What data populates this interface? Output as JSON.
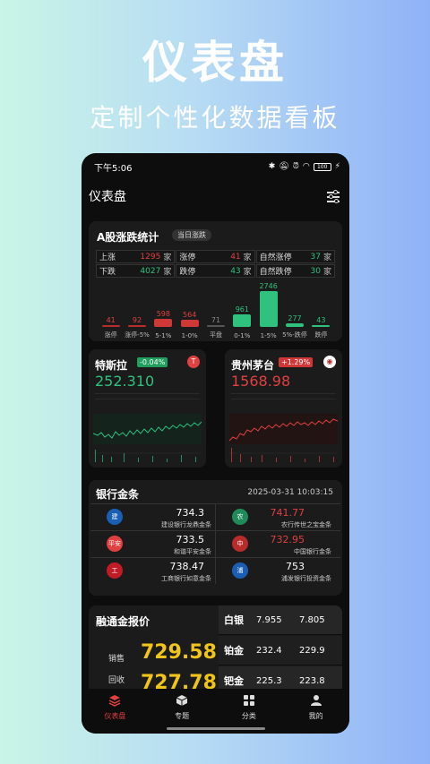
{
  "promo": {
    "title": "仪表盘",
    "subtitle": "定制个性化数据看板"
  },
  "status": {
    "time": "下午5:06",
    "battery": "100"
  },
  "header": {
    "title": "仪表盘"
  },
  "limit_stats": {
    "title": "A股涨跌统计",
    "pill": "当日涨跌",
    "rows": [
      [
        {
          "label": "上涨",
          "value": "1295",
          "unit": "家",
          "color": "red"
        },
        {
          "label": "涨停",
          "value": "41",
          "unit": "家",
          "color": "red"
        },
        {
          "label": "自然涨停",
          "value": "37",
          "unit": "家",
          "color": "green"
        }
      ],
      [
        {
          "label": "下跌",
          "value": "4027",
          "unit": "家",
          "color": "green"
        },
        {
          "label": "跌停",
          "value": "43",
          "unit": "家",
          "color": "green"
        },
        {
          "label": "自然跌停",
          "value": "30",
          "unit": "家",
          "color": "green"
        }
      ]
    ],
    "bars": [
      {
        "label": "涨停",
        "value": 41,
        "color": "#b82c2c",
        "text": "red"
      },
      {
        "label": "涨停-5%",
        "value": 92,
        "color": "#b82c2c",
        "text": "red"
      },
      {
        "label": "5-1%",
        "value": 598,
        "color": "#d03838",
        "text": "red"
      },
      {
        "label": "1-0%",
        "value": 564,
        "color": "#d03838",
        "text": "red"
      },
      {
        "label": "平盘",
        "value": 71,
        "color": "#555",
        "text": "grey"
      },
      {
        "label": "0-1%",
        "value": 961,
        "color": "#2ec27e",
        "text": "green"
      },
      {
        "label": "1-5%",
        "value": 2746,
        "color": "#2ec27e",
        "text": "green"
      },
      {
        "label": "5%-跌停",
        "value": 277,
        "color": "#2ec27e",
        "text": "green"
      },
      {
        "label": "跌停",
        "value": 43,
        "color": "#2ec27e",
        "text": "green"
      }
    ]
  },
  "stocks": [
    {
      "name": "特斯拉",
      "change": "-0.04%",
      "price": "252.310",
      "price_color": "green",
      "change_bg": "#1f9e5e",
      "logo": "T",
      "logo_bg": "#e04040"
    },
    {
      "name": "贵州茅台",
      "change": "+1.29%",
      "price": "1568.98",
      "price_color": "red",
      "change_bg": "#d03838",
      "logo": "◉",
      "logo_bg": "#ffffff"
    }
  ],
  "bank_gold": {
    "title": "银行金条",
    "timestamp": "2025-03-31 10:03:15",
    "items": [
      [
        {
          "price": "734.3",
          "name": "建设银行龙鼎金条",
          "color": "white",
          "logo": "建",
          "logo_bg": "#1a5fb4"
        },
        {
          "price": "741.77",
          "name": "农行传世之宝金条",
          "color": "red",
          "logo": "农",
          "logo_bg": "#1f8a5a"
        }
      ],
      [
        {
          "price": "733.5",
          "name": "和谐平安金条",
          "color": "white",
          "logo": "平安",
          "logo_bg": "#e04040"
        },
        {
          "price": "732.95",
          "name": "中国银行金条",
          "color": "red",
          "logo": "中",
          "logo_bg": "#b82c2c"
        }
      ],
      [
        {
          "price": "738.47",
          "name": "工商银行如意金条",
          "color": "white",
          "logo": "工",
          "logo_bg": "#c01c28"
        },
        {
          "price": "753",
          "name": "浦发银行投资金条",
          "color": "white",
          "logo": "浦",
          "logo_bg": "#1a5fb4"
        }
      ]
    ]
  },
  "quote": {
    "title": "融通金报价",
    "sell_label": "销售",
    "sell_value": "729.58",
    "buy_label": "回收",
    "buy_value": "727.78",
    "metals": [
      {
        "name": "白银",
        "a": "7.955",
        "b": "7.805"
      },
      {
        "name": "铂金",
        "a": "232.4",
        "b": "229.9"
      },
      {
        "name": "钯金",
        "a": "225.3",
        "b": "223.8"
      }
    ]
  },
  "tabs": [
    {
      "label": "仪表盘",
      "icon": "layers-icon",
      "active": true
    },
    {
      "label": "专题",
      "icon": "cube-icon",
      "active": false
    },
    {
      "label": "分类",
      "icon": "grid-icon",
      "active": false
    },
    {
      "label": "我的",
      "icon": "user-icon",
      "active": false
    }
  ]
}
